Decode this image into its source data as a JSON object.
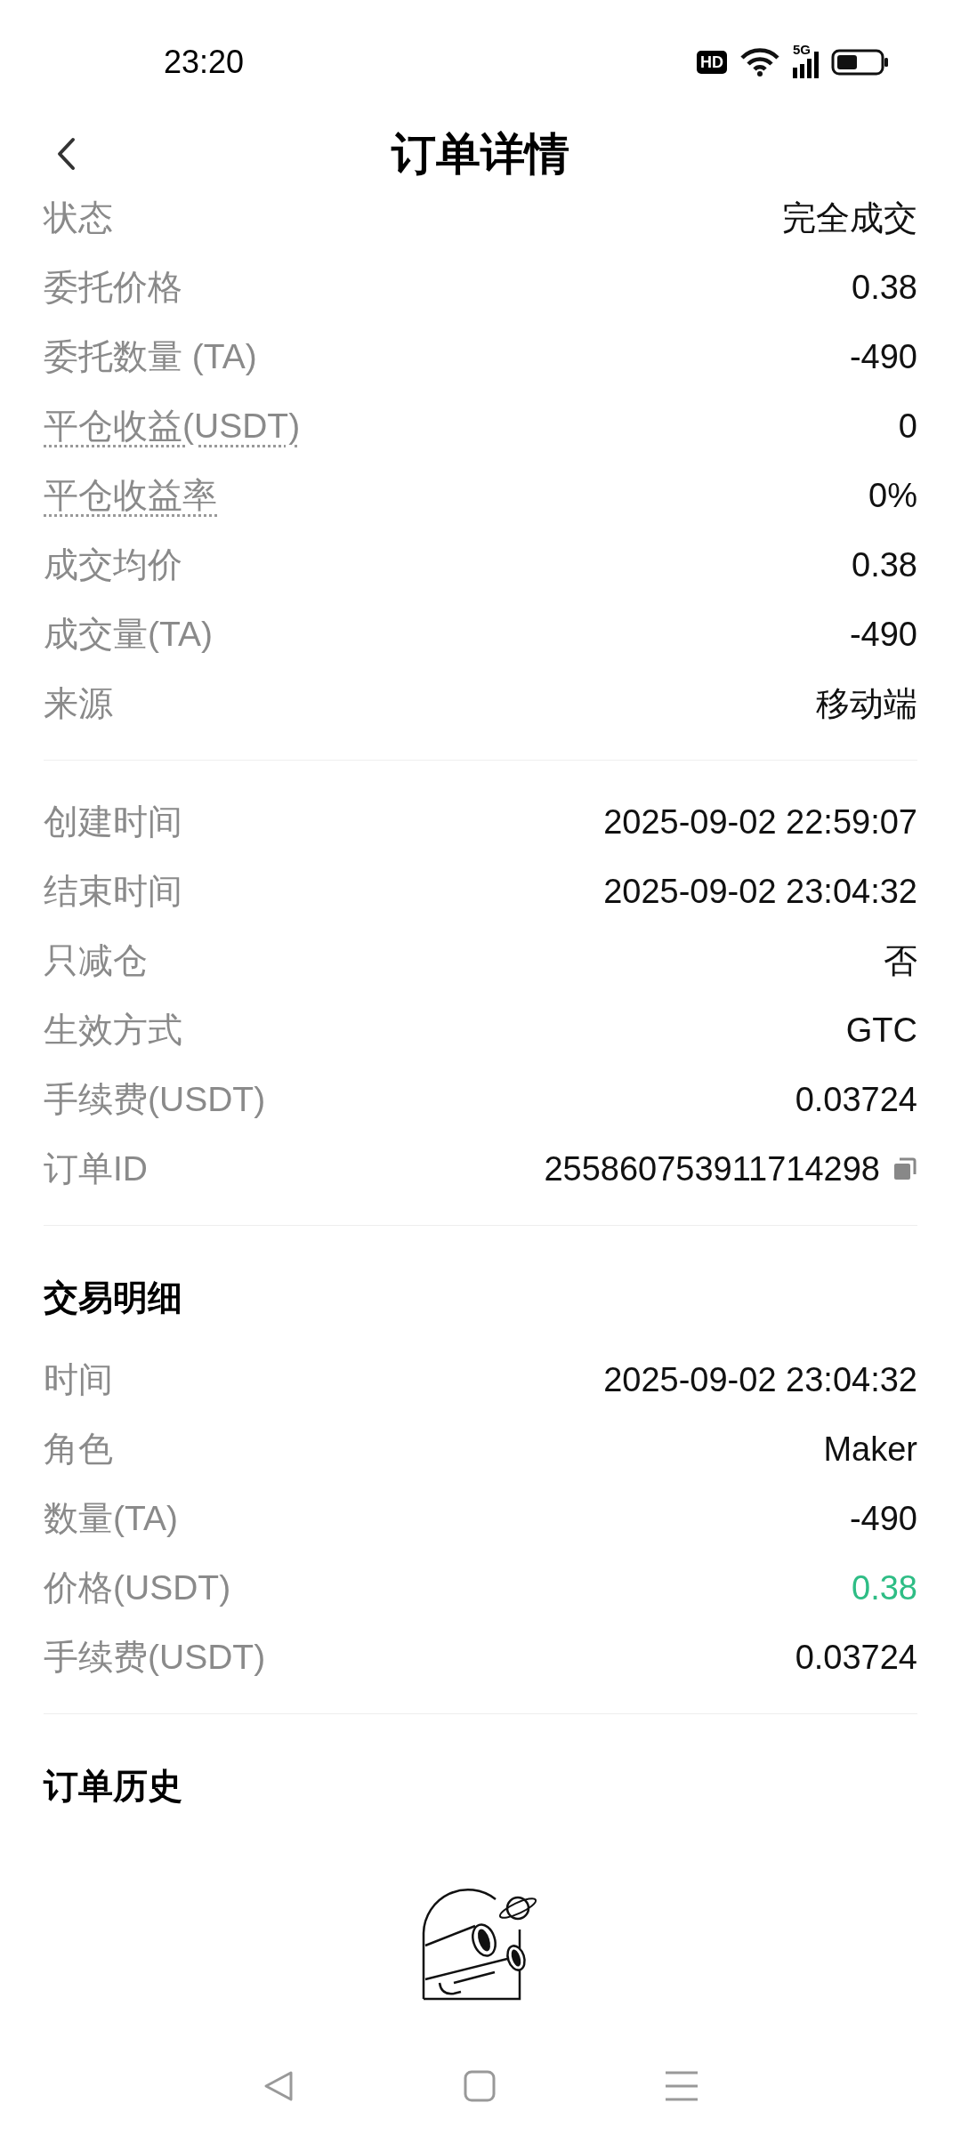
{
  "status_bar": {
    "time": "23:20",
    "hd_badge": "HD",
    "network": "5G"
  },
  "header": {
    "title": "订单详情"
  },
  "sections": [
    {
      "rows": [
        {
          "label": "状态",
          "value": "完全成交",
          "hint": false
        },
        {
          "label": "委托价格",
          "value": "0.38",
          "hint": false
        },
        {
          "label": "委托数量 (TA)",
          "value": "-490",
          "hint": false
        },
        {
          "label": "平仓收益(USDT)",
          "value": "0",
          "hint": true
        },
        {
          "label": "平仓收益率",
          "value": "0%",
          "hint": true
        },
        {
          "label": "成交均价",
          "value": "0.38",
          "hint": false
        },
        {
          "label": "成交量(TA)",
          "value": "-490",
          "hint": false
        },
        {
          "label": "来源",
          "value": "移动端",
          "hint": false
        }
      ]
    },
    {
      "rows": [
        {
          "label": "创建时间",
          "value": "2025-09-02 22:59:07",
          "hint": false
        },
        {
          "label": "结束时间",
          "value": "2025-09-02 23:04:32",
          "hint": false
        },
        {
          "label": "只减仓",
          "value": "否",
          "hint": false
        },
        {
          "label": "生效方式",
          "value": "GTC",
          "hint": false
        },
        {
          "label": "手续费(USDT)",
          "value": "0.03724",
          "hint": false
        },
        {
          "label": "订单ID",
          "value": "255860753911714298",
          "hint": false,
          "copyable": true
        }
      ]
    },
    {
      "title": "交易明细",
      "rows": [
        {
          "label": "时间",
          "value": "2025-09-02 23:04:32",
          "hint": false
        },
        {
          "label": "角色",
          "value": "Maker",
          "hint": false
        },
        {
          "label": "数量(TA)",
          "value": "-490",
          "hint": false
        },
        {
          "label": "价格(USDT)",
          "value": "0.38",
          "hint": false,
          "color": "#2ebd85"
        },
        {
          "label": "手续费(USDT)",
          "value": "0.03724",
          "hint": false
        }
      ]
    },
    {
      "title": "订单历史",
      "empty": true
    }
  ]
}
